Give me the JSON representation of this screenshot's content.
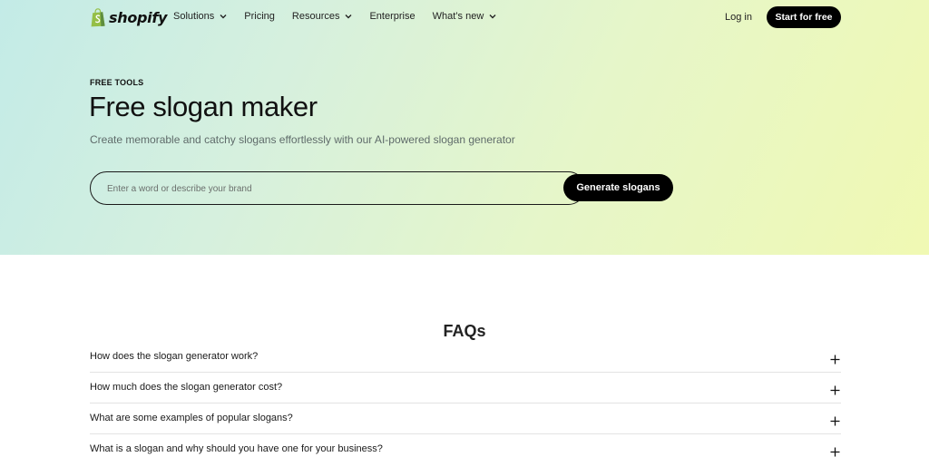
{
  "brand": {
    "name": "shopify",
    "accent": "#95bf47"
  },
  "nav": {
    "items": [
      {
        "label": "Solutions",
        "has_dropdown": true
      },
      {
        "label": "Pricing",
        "has_dropdown": false
      },
      {
        "label": "Resources",
        "has_dropdown": true
      },
      {
        "label": "Enterprise",
        "has_dropdown": false
      },
      {
        "label": "What’s new",
        "has_dropdown": true
      }
    ],
    "login_label": "Log in",
    "cta_label": "Start for free"
  },
  "hero": {
    "eyebrow": "FREE TOOLS",
    "title": "Free slogan maker",
    "subtitle": "Create memorable and catchy slogans effortlessly with our AI-powered slogan generator",
    "search": {
      "placeholder": "Enter a word or describe your brand",
      "value": "",
      "button_label": "Generate slogans"
    }
  },
  "faq": {
    "title": "FAQs",
    "items": [
      {
        "question": "How does the slogan generator work?",
        "icon": "plus-icon"
      },
      {
        "question": "How much does the slogan generator cost?",
        "icon": "plus-icon"
      },
      {
        "question": "What are some examples of popular slogans?",
        "icon": "plus-icon"
      },
      {
        "question": "What is a slogan and why should you have one for your business?",
        "icon": "plus-icon"
      }
    ]
  },
  "colors": {
    "hero_gradient_start": "#c3ebe7",
    "hero_gradient_end": "#f0f9b3",
    "button_bg": "#000000",
    "button_text": "#ffffff"
  }
}
